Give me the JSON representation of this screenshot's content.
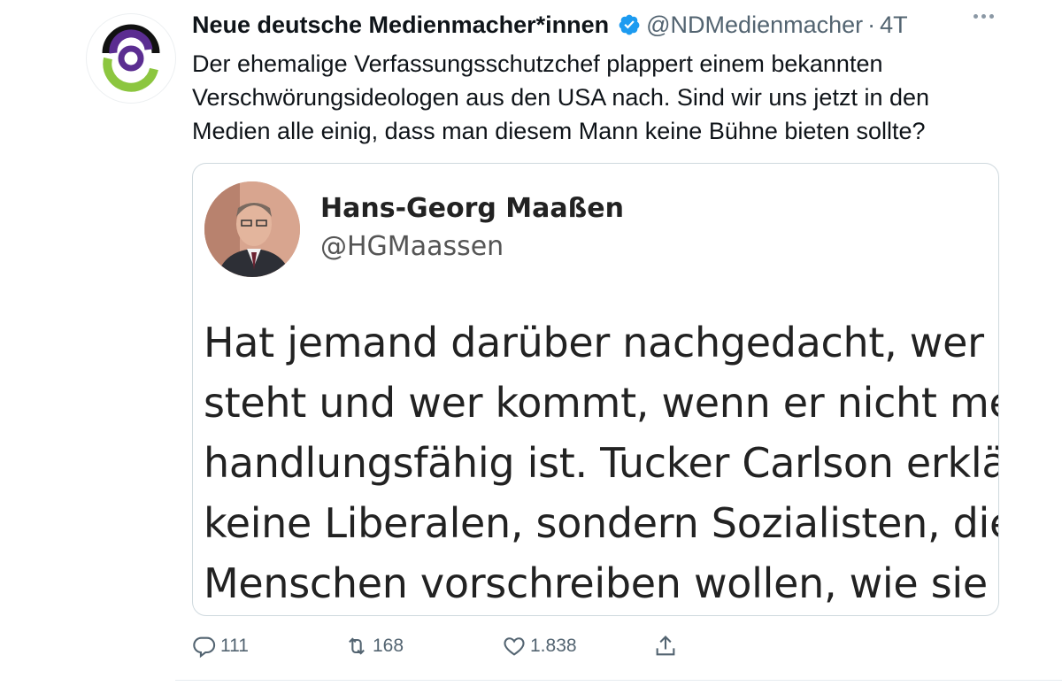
{
  "author": {
    "display_name": "Neue deutsche Medienmacher*innen",
    "handle": "@NDMedienmacher",
    "separator": "·",
    "time": "4T",
    "avatar": "ndm-logo-icon",
    "verified": true
  },
  "tweet": {
    "lines": [
      "Der ehemalige Verfassungsschutzchef plappert einem bekannten",
      "Verschwörungsideologen aus den USA nach. Sind wir uns jetzt in den",
      "Medien alle einig, dass man diesem Mann keine Bühne bieten sollte?"
    ]
  },
  "quote": {
    "name": "Hans-Georg Maaßen",
    "handle": "@HGMaassen",
    "body_lines": [
      "Hat jemand darüber nachgedacht, wer h",
      "steht und wer kommt, wenn er nicht me",
      "handlungsfähig ist. Tucker Carlson erklär",
      "keine Liberalen, sondern Sozialisten, die",
      "Menschen vorschreiben wollen, wie sie z"
    ]
  },
  "actions": {
    "reply_count": "111",
    "retweet_count": "168",
    "like_count": "1.838"
  },
  "colors": {
    "verified": "#1d9bf0",
    "logo_purple": "#5b2d91",
    "logo_green": "#8cc63f",
    "secondary_text": "#536471"
  }
}
